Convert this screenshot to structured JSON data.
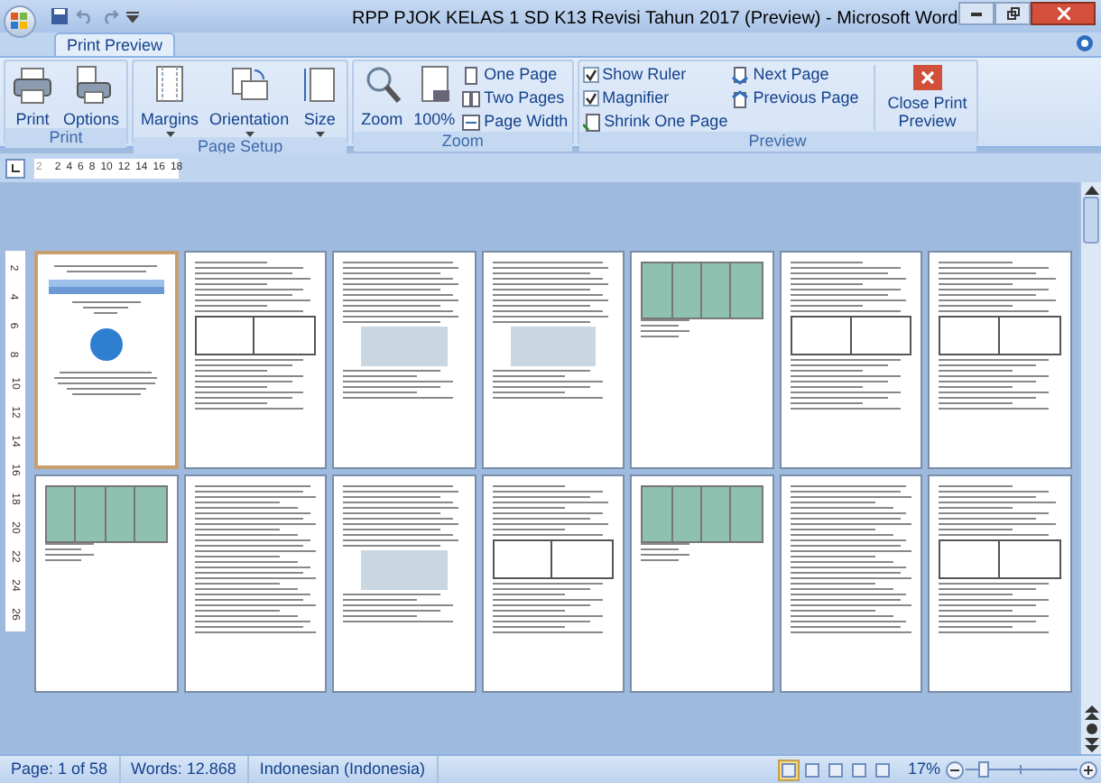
{
  "window": {
    "title": "RPP PJOK KELAS 1 SD K13 Revisi Tahun 2017 (Preview) - Microsoft Word"
  },
  "tabs": [
    {
      "label": "Print Preview",
      "selected": true
    }
  ],
  "ribbon_groups": [
    {
      "label": "Print",
      "items": [
        {
          "kind": "large",
          "label": "Print"
        },
        {
          "kind": "large",
          "label": "Options"
        }
      ]
    },
    {
      "label": "Page Setup",
      "items": [
        {
          "kind": "large",
          "label": "Margins",
          "dropdown": true
        },
        {
          "kind": "large",
          "label": "Orientation",
          "dropdown": true
        },
        {
          "kind": "large",
          "label": "Size",
          "dropdown": true
        }
      ]
    },
    {
      "label": "Zoom",
      "items": [
        {
          "kind": "large",
          "label": "Zoom"
        },
        {
          "kind": "large",
          "label": "100%"
        },
        {
          "kind": "small",
          "label": "One Page"
        },
        {
          "kind": "small",
          "label": "Two Pages"
        },
        {
          "kind": "small",
          "label": "Page Width"
        }
      ]
    },
    {
      "label": "Preview",
      "items": [
        {
          "kind": "check",
          "label": "Show Ruler",
          "checked": true
        },
        {
          "kind": "check",
          "label": "Magnifier",
          "checked": true
        },
        {
          "kind": "small",
          "label": "Shrink One Page"
        },
        {
          "kind": "small",
          "label": "Next Page"
        },
        {
          "kind": "small",
          "label": "Previous Page"
        },
        {
          "kind": "close",
          "label": "Close Print Preview"
        }
      ]
    }
  ],
  "ruler": {
    "horizontal": [
      "2",
      "2",
      "4",
      "6",
      "8",
      "10",
      "12",
      "14",
      "16",
      "18"
    ],
    "vertical": [
      "2",
      "4",
      "6",
      "8",
      "10",
      "12",
      "14",
      "16",
      "18",
      "20",
      "22",
      "24",
      "26"
    ]
  },
  "pages": [
    {
      "kind": "cover",
      "selected": true
    },
    {
      "kind": "table",
      "selected": false
    },
    {
      "kind": "photo",
      "selected": false
    },
    {
      "kind": "photo",
      "selected": false
    },
    {
      "kind": "grid",
      "selected": false
    },
    {
      "kind": "table",
      "selected": false
    },
    {
      "kind": "table",
      "selected": false
    },
    {
      "kind": "grid",
      "selected": false
    },
    {
      "kind": "text",
      "selected": false
    },
    {
      "kind": "photo",
      "selected": false
    },
    {
      "kind": "table",
      "selected": false
    },
    {
      "kind": "grid",
      "selected": false
    },
    {
      "kind": "text",
      "selected": false
    },
    {
      "kind": "table",
      "selected": false
    }
  ],
  "status_bar": {
    "items": [
      "Page: 1 of 58",
      "Words: 12.868",
      "Indonesian (Indonesia)"
    ],
    "views": [
      {
        "selected": true
      },
      {
        "selected": false
      },
      {
        "selected": false
      },
      {
        "selected": false
      },
      {
        "selected": false
      }
    ],
    "zoom": "17%",
    "zoom_slider": {
      "level": 0.12
    }
  }
}
